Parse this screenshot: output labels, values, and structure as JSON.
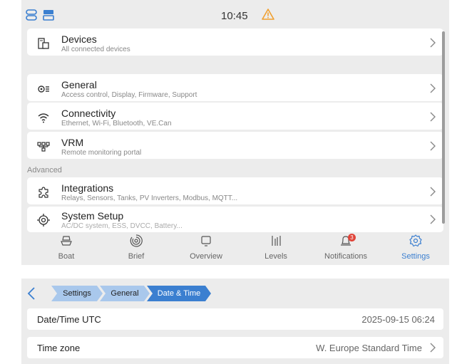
{
  "status_bar": {
    "time": "10:45",
    "icons": [
      "toggle-layout-icon",
      "split-view-icon",
      "warning-icon"
    ]
  },
  "settings": {
    "devices": {
      "title": "Devices",
      "subtitle": "All connected devices",
      "icon": "devices-icon"
    },
    "items": [
      {
        "title": "General",
        "subtitle": "Access control, Display, Firmware, Support",
        "icon": "general-settings-icon"
      },
      {
        "title": "Connectivity",
        "subtitle": "Ethernet, Wi-Fi, Bluetooth, VE.Can",
        "icon": "wifi-icon"
      },
      {
        "title": "VRM",
        "subtitle": "Remote monitoring portal",
        "icon": "vrm-network-icon"
      }
    ],
    "advanced_label": "Advanced",
    "advanced_items": [
      {
        "title": "Integrations",
        "subtitle": "Relays, Sensors, Tanks, PV Inverters, Modbus, MQTT...",
        "icon": "puzzle-icon"
      },
      {
        "title": "System Setup",
        "subtitle": "AC/DC system, ESS, DVCC, Battery...",
        "icon": "target-icon"
      }
    ]
  },
  "tabs": [
    {
      "label": "Boat",
      "icon": "boat-icon"
    },
    {
      "label": "Brief",
      "icon": "brief-icon"
    },
    {
      "label": "Overview",
      "icon": "overview-icon"
    },
    {
      "label": "Levels",
      "icon": "levels-icon"
    },
    {
      "label": "Notifications",
      "icon": "bell-icon",
      "badge": "3"
    },
    {
      "label": "Settings",
      "icon": "settings-icon",
      "active": true
    }
  ],
  "breadcrumb": [
    "Settings",
    "General",
    "Date & Time"
  ],
  "datetime": {
    "rows": [
      {
        "label": "Date/Time UTC",
        "value": "2025-09-15 06:24"
      },
      {
        "label": "Time zone",
        "value": "W. Europe Standard Time"
      }
    ]
  },
  "colors": {
    "accent": "#3b7fd0",
    "crumb_inactive": "#a9c8ec",
    "warning": "#f0a030",
    "badge": "#e0453a"
  }
}
